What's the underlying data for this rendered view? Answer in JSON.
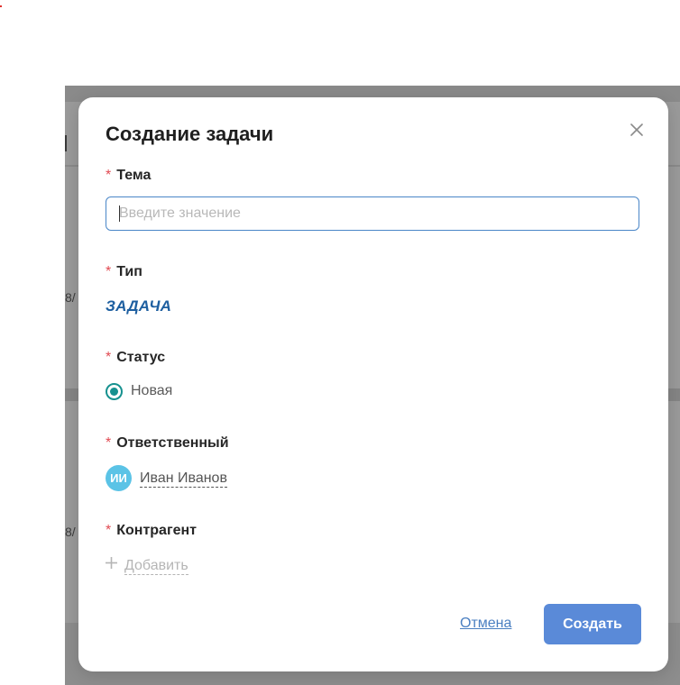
{
  "background": {
    "fragments": [
      "8/",
      "8/"
    ]
  },
  "modal": {
    "title": "Создание задачи",
    "close_icon": "close-icon",
    "required_marker": "*",
    "fields": {
      "subject": {
        "label": "Тема",
        "value": "",
        "placeholder": "Введите значение"
      },
      "type": {
        "label": "Тип",
        "value": "ЗАДАЧА"
      },
      "status": {
        "label": "Статус",
        "value": "Новая"
      },
      "assignee": {
        "label": "Ответственный",
        "initials": "ИИ",
        "name": "Иван Иванов"
      },
      "counterparty": {
        "label": "Контрагент",
        "add_label": "Добавить",
        "icon": "plus-icon"
      }
    },
    "footer": {
      "cancel_label": "Отмена",
      "create_label": "Создать"
    }
  },
  "colors": {
    "accent": "#5a8ad8",
    "required": "#e14a52",
    "type": "#1e5fa0",
    "status_radio": "#16918f",
    "avatar": "#5bc3e6",
    "link": "#4a7fc1"
  }
}
